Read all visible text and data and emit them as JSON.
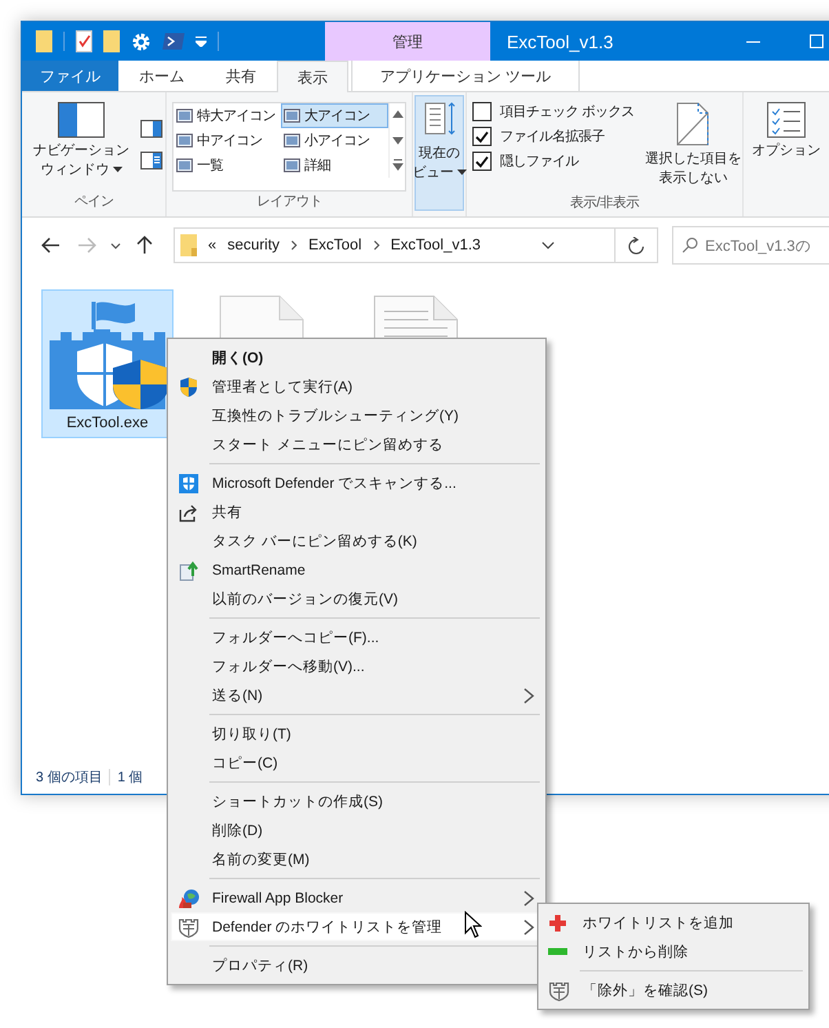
{
  "window": {
    "title": "ExcTool_v1.3",
    "context_tab": "管理"
  },
  "ribbon_tabs": [
    {
      "label": "ファイル",
      "kind": "filetab",
      "selected": false
    },
    {
      "label": "ホーム",
      "kind": "tab",
      "selected": false
    },
    {
      "label": "共有",
      "kind": "tab",
      "selected": false
    },
    {
      "label": "表示",
      "kind": "tab",
      "selected": true
    },
    {
      "label": "アプリケーション ツール",
      "kind": "contextual",
      "selected": false
    }
  ],
  "ribbon": {
    "pane": {
      "nav_button": [
        "ナビゲーション",
        "ウィンドウ"
      ],
      "group_label": "ペイン"
    },
    "layout": {
      "items": [
        {
          "label": "特大アイコン",
          "selected": false
        },
        {
          "label": "大アイコン",
          "selected": true
        },
        {
          "label": "中アイコン",
          "selected": false
        },
        {
          "label": "小アイコン",
          "selected": false
        },
        {
          "label": "一覧",
          "selected": false
        },
        {
          "label": "詳細",
          "selected": false
        }
      ],
      "group_label": "レイアウト"
    },
    "current_view": {
      "label_lines": [
        "現在の",
        "ビュー"
      ],
      "selected": true
    },
    "show_hide": {
      "checkboxes": [
        {
          "label": "項目チェック ボックス",
          "checked": false
        },
        {
          "label": "ファイル名拡張子",
          "checked": true
        },
        {
          "label": "隠しファイル",
          "checked": true
        }
      ],
      "hide_selected": [
        "選択した項目を",
        "表示しない"
      ],
      "group_label": "表示/非表示"
    },
    "options": {
      "label": "オプション"
    }
  },
  "address": {
    "overflow_mark": "«",
    "path": [
      "security",
      "ExcTool",
      "ExcTool_v1.3"
    ],
    "search_placeholder": "ExcTool_v1.3の"
  },
  "files": [
    {
      "name": "ExcTool.exe",
      "kind": "app",
      "selected": true
    },
    {
      "kind": "blank",
      "selected": false
    },
    {
      "kind": "text",
      "selected": false
    }
  ],
  "status_bar": {
    "items": [
      "3 個の項目",
      "1 個"
    ]
  },
  "context_menu": {
    "items": [
      {
        "kind": "item",
        "label": "開く(O)",
        "default": true,
        "submenu": false,
        "selected": false
      },
      {
        "kind": "item",
        "label": "管理者として実行(A)",
        "default": false,
        "submenu": false,
        "selected": false
      },
      {
        "kind": "item",
        "label": "互換性のトラブルシューティング(Y)",
        "default": false,
        "submenu": false,
        "selected": false
      },
      {
        "kind": "item",
        "label": "スタート メニューにピン留めする",
        "default": false,
        "submenu": false,
        "selected": false
      },
      {
        "kind": "separator"
      },
      {
        "kind": "item",
        "label": "Microsoft Defender でスキャンする...",
        "default": false,
        "submenu": false,
        "selected": false
      },
      {
        "kind": "item",
        "label": "共有",
        "default": false,
        "submenu": false,
        "selected": false
      },
      {
        "kind": "item",
        "label": "タスク バーにピン留めする(K)",
        "default": false,
        "submenu": false,
        "selected": false
      },
      {
        "kind": "item",
        "label": "SmartRename",
        "default": false,
        "submenu": false,
        "selected": false
      },
      {
        "kind": "item",
        "label": "以前のバージョンの復元(V)",
        "default": false,
        "submenu": false,
        "selected": false
      },
      {
        "kind": "separator"
      },
      {
        "kind": "item",
        "label": "フォルダーへコピー(F)...",
        "default": false,
        "submenu": false,
        "selected": false
      },
      {
        "kind": "item",
        "label": "フォルダーへ移動(V)...",
        "default": false,
        "submenu": false,
        "selected": false
      },
      {
        "kind": "item",
        "label": "送る(N)",
        "default": false,
        "submenu": true,
        "selected": false
      },
      {
        "kind": "separator"
      },
      {
        "kind": "item",
        "label": "切り取り(T)",
        "default": false,
        "submenu": false,
        "selected": false
      },
      {
        "kind": "item",
        "label": "コピー(C)",
        "default": false,
        "submenu": false,
        "selected": false
      },
      {
        "kind": "separator"
      },
      {
        "kind": "item",
        "label": "ショートカットの作成(S)",
        "default": false,
        "submenu": false,
        "selected": false
      },
      {
        "kind": "item",
        "label": "削除(D)",
        "default": false,
        "submenu": false,
        "selected": false
      },
      {
        "kind": "item",
        "label": "名前の変更(M)",
        "default": false,
        "submenu": false,
        "selected": false
      },
      {
        "kind": "separator"
      },
      {
        "kind": "item",
        "label": "Firewall App Blocker",
        "default": false,
        "submenu": true,
        "selected": false
      },
      {
        "kind": "item",
        "label": "Defender のホワイトリストを管理",
        "default": false,
        "submenu": true,
        "selected": true
      },
      {
        "kind": "separator"
      },
      {
        "kind": "item",
        "label": "プロパティ(R)",
        "default": false,
        "submenu": false,
        "selected": false
      }
    ]
  },
  "submenu": {
    "items": [
      {
        "kind": "item",
        "label": "ホワイトリストを追加",
        "default": false,
        "submenu": false,
        "selected": false
      },
      {
        "kind": "item",
        "label": "リストから削除",
        "default": false,
        "submenu": false,
        "selected": false
      },
      {
        "kind": "separator"
      },
      {
        "kind": "item",
        "label": "「除外」を確認(S)",
        "default": false,
        "submenu": false,
        "selected": false
      }
    ]
  }
}
